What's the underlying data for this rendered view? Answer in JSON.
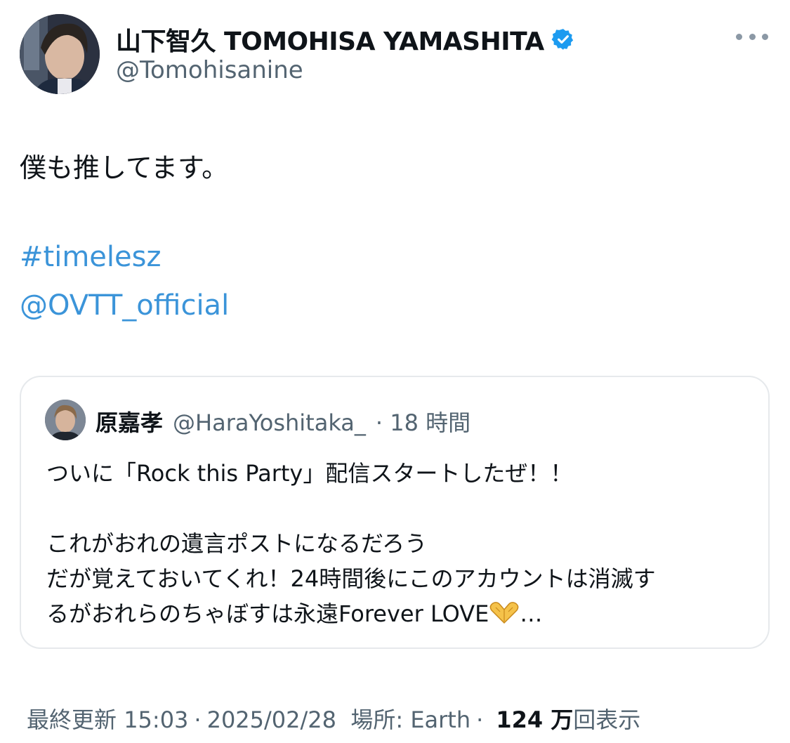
{
  "author": {
    "display_name": "山下智久 TOMOHISA YAMASHITA",
    "handle": "@Tomohisanine",
    "verified_color": "#1d9bf0"
  },
  "tweet": {
    "text": "僕も推してます。",
    "hashtag": "#timelesz",
    "mention": "@OVTT_official"
  },
  "quote": {
    "display_name": "原嘉孝",
    "handle": "@HaraYoshitaka_",
    "time": "· 18 時間",
    "line1": "ついに「Rock this Party」配信スタートしたぜ！！",
    "line2": "これがおれの遺言ポストになるだろう",
    "line3": "だが覚えておいてくれ！24時間後にこのアカウントは消滅す",
    "line4_text": "るがおれらのちゃぼすは永遠Forever LOVE",
    "line4_emoji": "heart-hands",
    "line4_ellipsis": "…"
  },
  "footer": {
    "updated_label": "最終更新",
    "time": "15:03",
    "date": "2025/02/28",
    "location": "場所: Earth",
    "views_count": "124 万",
    "views_label": "回表示"
  },
  "colors": {
    "link": "#3b94d9",
    "secondary_text": "#536471",
    "border": "#e6e9ec"
  }
}
